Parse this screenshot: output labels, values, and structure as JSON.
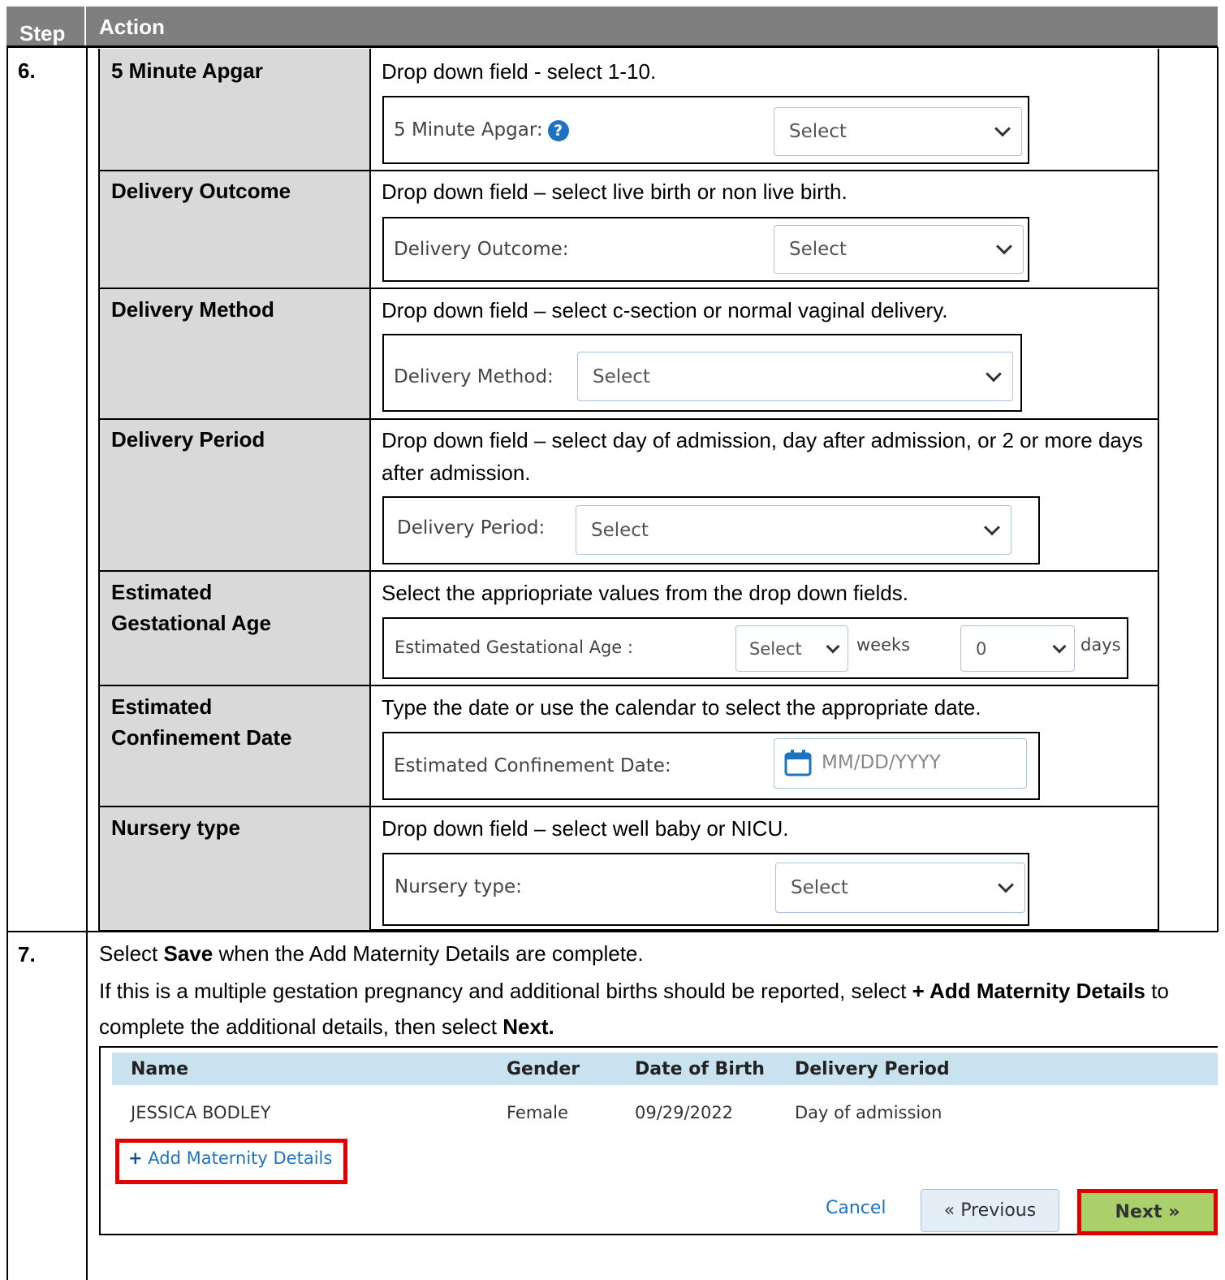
{
  "header": {
    "step": "Step",
    "action": "Action"
  },
  "step6": {
    "number": "6.",
    "rows": [
      {
        "label": "5 Minute Apgar",
        "desc": "Drop down field - select 1-10.",
        "field_label": "5 Minute Apgar:",
        "select": "Select"
      },
      {
        "label": "Delivery Outcome",
        "desc": "Drop down field – select live birth or non live birth.",
        "field_label": "Delivery Outcome:",
        "select": "Select"
      },
      {
        "label": "Delivery Method",
        "desc": "Drop down field – select c-section or normal vaginal delivery.",
        "field_label": "Delivery Method:",
        "select": "Select"
      },
      {
        "label": "Delivery Period",
        "desc": "Drop down field – select day of admission, day after admission, or 2 or more days after admission.",
        "field_label": "Delivery Period:",
        "select": "Select"
      },
      {
        "label": "Estimated Gestational Age",
        "desc": "Select the appriopriate values from the drop down fields.",
        "field_label": "Estimated Gestational Age :",
        "weeks_select": "Select",
        "weeks_unit": "weeks",
        "days_select": "0",
        "days_unit": "days"
      },
      {
        "label": "Estimated Confinement Date",
        "desc": "Type the date or use the calendar to select the appropriate date.",
        "field_label": "Estimated Confinement Date:",
        "date_placeholder": "MM/DD/YYYY"
      },
      {
        "label": "Nursery type",
        "desc": "Drop down field – select well baby or NICU.",
        "field_label": "Nursery type:",
        "select": "Select"
      }
    ]
  },
  "step7": {
    "number": "7.",
    "line1": {
      "pre": "Select ",
      "bold": "Save",
      "post": " when the Add Maternity Details are complete."
    },
    "line2": {
      "pre": "If this is a multiple gestation pregnancy and additional births should be reported, select ",
      "bold1": "+ Add Maternity Details",
      "mid": " to complete the additional details, then select ",
      "bold2": "Next."
    },
    "table": {
      "columns": [
        "Name",
        "Gender",
        "Date of Birth",
        "Delivery Period"
      ],
      "rows": [
        [
          "JESSICA BODLEY",
          "Female",
          "09/29/2022",
          "Day of admission"
        ]
      ]
    },
    "add_link": "Add Maternity Details",
    "buttons": {
      "cancel": "Cancel",
      "previous": "« Previous",
      "next": "Next »"
    }
  },
  "colors": {
    "header_bg": "#7f7f7f",
    "label_bg": "#d9d9d9",
    "table_head_bg": "#c8e2ef",
    "next_bg": "#a9d06b",
    "highlight": "#e00000",
    "link": "#1e73be"
  }
}
